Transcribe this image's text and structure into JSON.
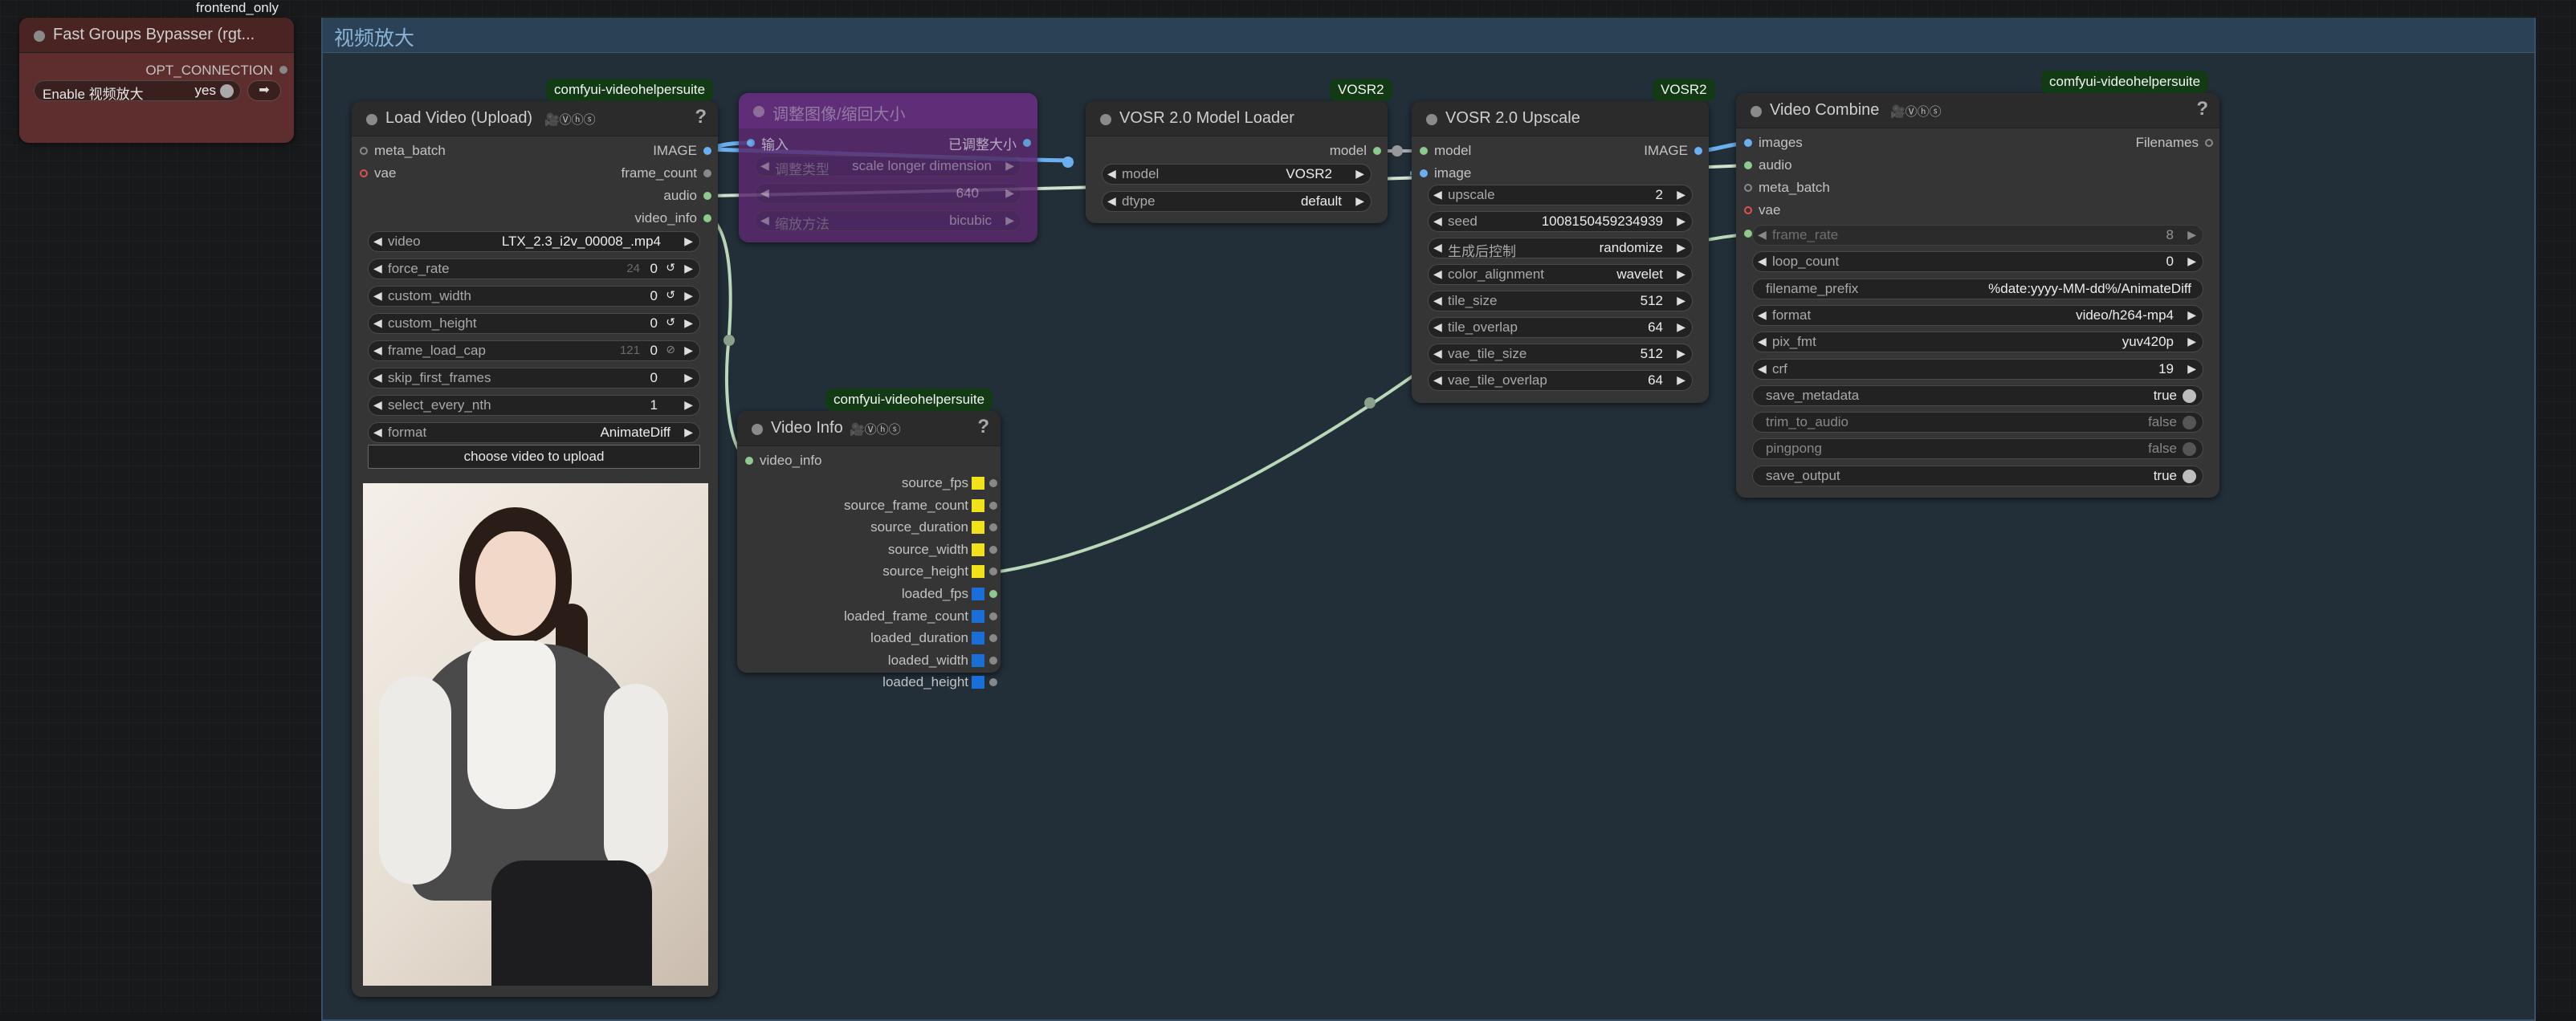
{
  "frontend_label": "frontend_only",
  "group": {
    "title": "视频放大"
  },
  "bypasser": {
    "title": "Fast Groups Bypasser (rgt...",
    "opt_connection": "OPT_CONNECTION",
    "toggle_label": "Enable 视频放大",
    "toggle_value": "yes"
  },
  "load_video": {
    "badge": "comfyui-videohelpersuite",
    "title": "Load Video (Upload)",
    "help": "?",
    "inputs": [
      "meta_batch",
      "vae"
    ],
    "outputs": [
      "IMAGE",
      "frame_count",
      "audio",
      "video_info"
    ],
    "widgets": {
      "video": {
        "label": "video",
        "value": "LTX_2.3_i2v_00008_.mp4"
      },
      "force_rate": {
        "label": "force_rate",
        "value": "0",
        "placeholder": "24"
      },
      "custom_width": {
        "label": "custom_width",
        "value": "0"
      },
      "custom_height": {
        "label": "custom_height",
        "value": "0"
      },
      "frame_load_cap": {
        "label": "frame_load_cap",
        "value": "0",
        "placeholder": "121"
      },
      "skip_first_frames": {
        "label": "skip_first_frames",
        "value": "0"
      },
      "select_every_nth": {
        "label": "select_every_nth",
        "value": "1"
      },
      "format": {
        "label": "format",
        "value": "AnimateDiff"
      }
    },
    "upload_button": "choose video to upload"
  },
  "resize_node": {
    "title": "调整图像/缩回大小",
    "input": "输入",
    "output": "已调整大小",
    "widgets": [
      {
        "label": "调整类型",
        "value": "scale longer dimension"
      },
      {
        "label": "",
        "value": "640"
      },
      {
        "label": "缩放方法",
        "value": "bicubic"
      }
    ]
  },
  "vosr_loader": {
    "badge": "VOSR2",
    "title": "VOSR 2.0 Model Loader",
    "output": "model",
    "widgets": [
      {
        "label": "model",
        "value": "VOSR2"
      },
      {
        "label": "dtype",
        "value": "default"
      }
    ]
  },
  "vosr_upscale": {
    "badge": "VOSR2",
    "title": "VOSR 2.0 Upscale",
    "inputs": [
      "model",
      "image"
    ],
    "output": "IMAGE",
    "widgets": [
      {
        "label": "upscale",
        "value": "2"
      },
      {
        "label": "seed",
        "value": "1008150459234939"
      },
      {
        "label": "生成后控制",
        "value": "randomize"
      },
      {
        "label": "color_alignment",
        "value": "wavelet"
      },
      {
        "label": "tile_size",
        "value": "512"
      },
      {
        "label": "tile_overlap",
        "value": "64"
      },
      {
        "label": "vae_tile_size",
        "value": "512"
      },
      {
        "label": "vae_tile_overlap",
        "value": "64"
      }
    ]
  },
  "video_combine": {
    "badge": "comfyui-videohelpersuite",
    "title": "Video Combine",
    "help": "?",
    "inputs": [
      "images",
      "audio",
      "meta_batch",
      "vae"
    ],
    "output": "Filenames",
    "widgets": [
      {
        "label": "frame_rate",
        "value": "8"
      },
      {
        "label": "loop_count",
        "value": "0"
      },
      {
        "label": "filename_prefix",
        "value": "%date:yyyy-MM-dd%/AnimateDiff"
      },
      {
        "label": "format",
        "value": "video/h264-mp4"
      },
      {
        "label": "pix_fmt",
        "value": "yuv420p"
      },
      {
        "label": "crf",
        "value": "19"
      },
      {
        "label": "save_metadata",
        "value": "true"
      },
      {
        "label": "trim_to_audio",
        "value": "false"
      },
      {
        "label": "pingpong",
        "value": "false"
      },
      {
        "label": "save_output",
        "value": "true"
      }
    ]
  },
  "video_info": {
    "badge": "comfyui-videohelpersuite",
    "title": "Video Info",
    "help": "?",
    "input": "video_info",
    "outputs": [
      "source_fps",
      "source_frame_count",
      "source_duration",
      "source_width",
      "source_height",
      "loaded_fps",
      "loaded_frame_count",
      "loaded_duration",
      "loaded_width",
      "loaded_height"
    ]
  },
  "colors": {
    "link_image": "#6ab0f0",
    "link_audio": "#8ec98e",
    "link_info": "#b8d8b8",
    "source_square": "#f1e11b",
    "loaded_square": "#1a6ed8",
    "badge_bg": "#123a14"
  }
}
